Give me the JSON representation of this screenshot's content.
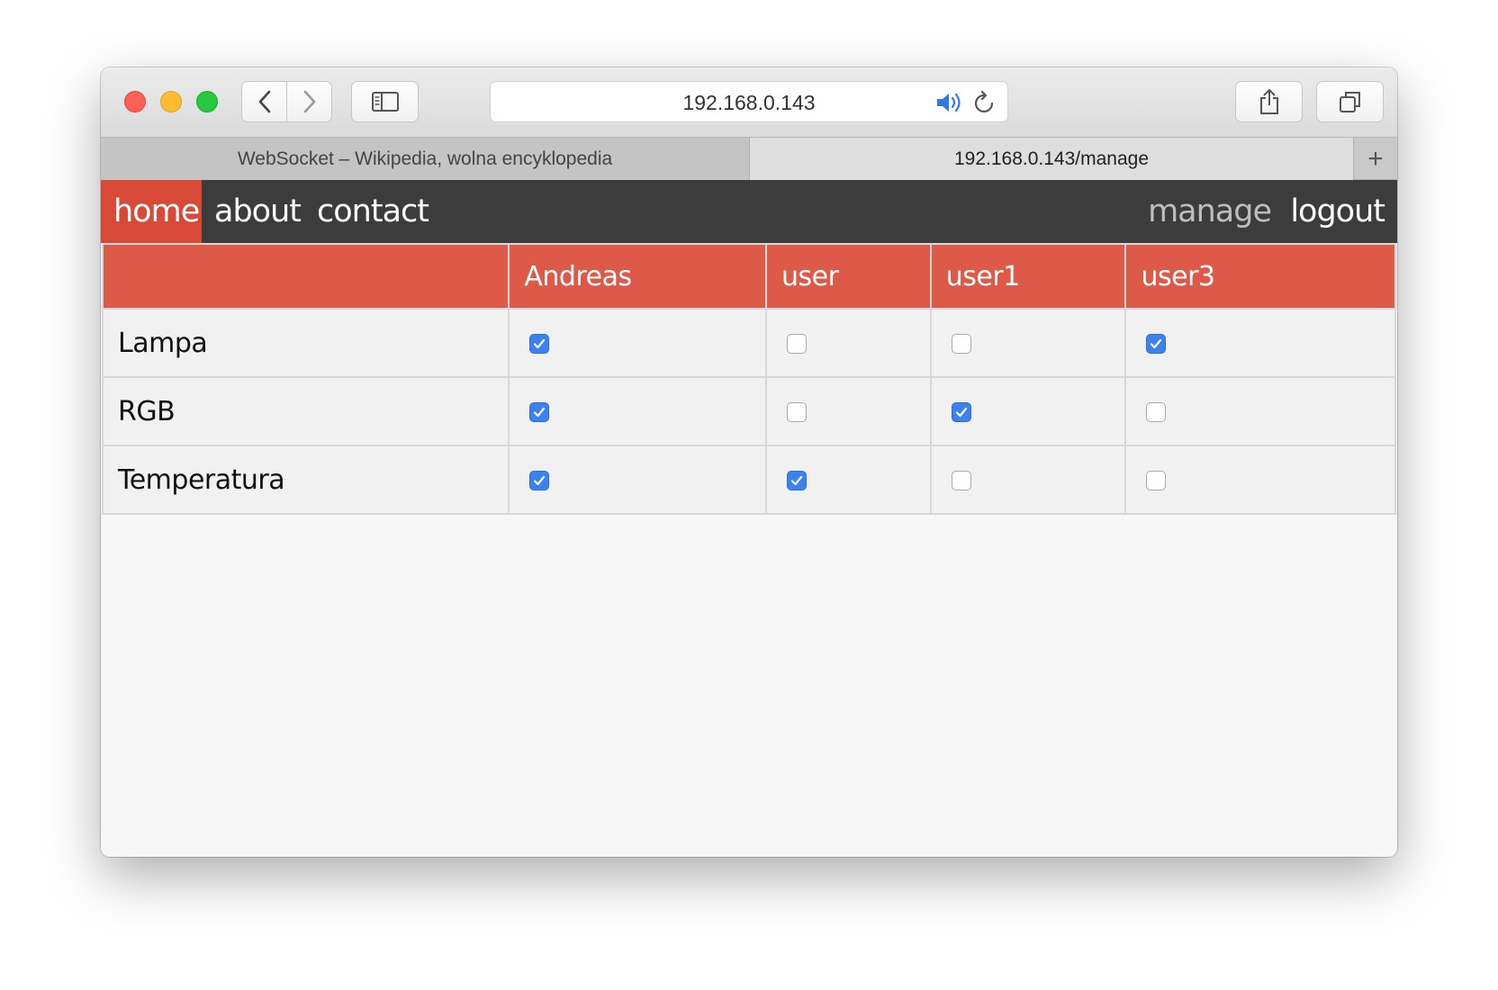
{
  "browser": {
    "address": "192.168.0.143",
    "tabs": [
      {
        "title": "WebSocket – Wikipedia, wolna encyklopedia",
        "active": false
      },
      {
        "title": "192.168.0.143/manage",
        "active": true
      }
    ],
    "new_tab_symbol": "+",
    "icons": [
      "back-icon",
      "forward-icon",
      "sidebar-icon",
      "speaker-icon",
      "reload-icon",
      "share-icon",
      "tabs-overview-icon"
    ]
  },
  "nav": {
    "home": "home",
    "about": "about",
    "contact": "contact",
    "manage": "manage",
    "logout": "logout"
  },
  "colors": {
    "nav_bg": "#3c3c3c",
    "accent": "#d84a37",
    "header_bg": "#de5a48",
    "checkbox": "#3b82f0"
  },
  "table": {
    "corner": "",
    "users": [
      "Andreas",
      "user",
      "user1",
      "user3"
    ],
    "rows": [
      {
        "device": "Lampa",
        "permissions": [
          true,
          false,
          false,
          true
        ]
      },
      {
        "device": "RGB",
        "permissions": [
          true,
          false,
          true,
          false
        ]
      },
      {
        "device": "Temperatura",
        "permissions": [
          true,
          true,
          false,
          false
        ]
      }
    ]
  }
}
